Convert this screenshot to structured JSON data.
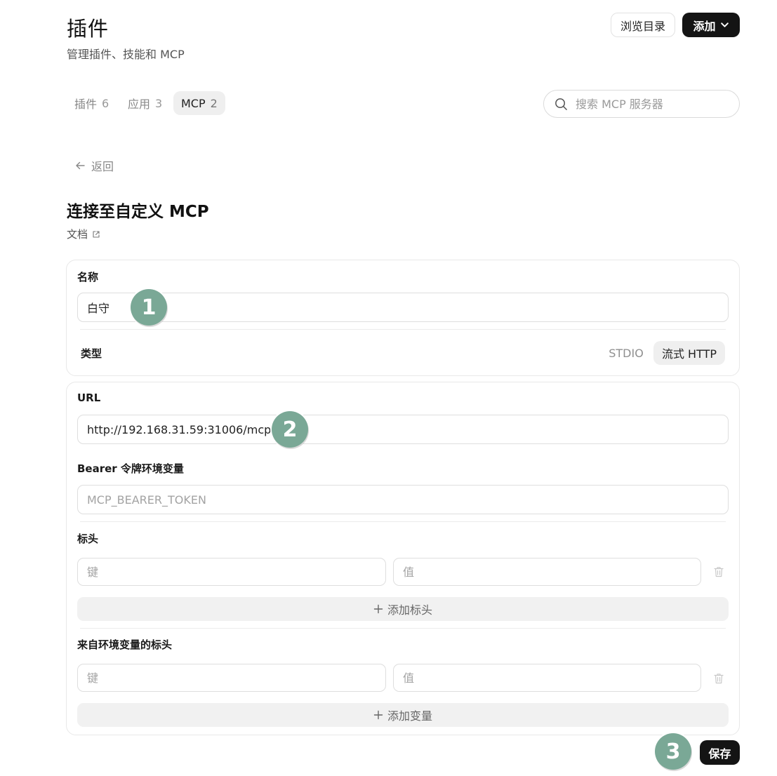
{
  "header": {
    "title": "插件",
    "subtitle": "管理插件、技能和 MCP",
    "browse_label": "浏览目录",
    "add_label": "添加"
  },
  "tabs": [
    {
      "label": "插件",
      "count": "6"
    },
    {
      "label": "应用",
      "count": "3"
    },
    {
      "label": "MCP",
      "count": "2"
    }
  ],
  "search": {
    "placeholder": "搜索 MCP 服务器"
  },
  "back_label": "返回",
  "form": {
    "title": "连接至自定义 MCP",
    "docs_label": "文档",
    "name_label": "名称",
    "name_value": "白守",
    "type_label": "类型",
    "type_options": [
      "STDIO",
      "流式 HTTP"
    ],
    "type_selected": "流式 HTTP",
    "url_label": "URL",
    "url_value": "http://192.168.31.59:31006/mcp",
    "bearer_label": "Bearer 令牌环境变量",
    "bearer_placeholder": "MCP_BEARER_TOKEN",
    "headers_label": "标头",
    "key_placeholder": "键",
    "value_placeholder": "值",
    "add_header_label": "添加标头",
    "env_headers_label": "来自环境变量的标头",
    "add_variable_label": "添加变量",
    "save_label": "保存"
  },
  "annotations": [
    "1",
    "2",
    "3"
  ],
  "colors": {
    "badge": "#7aa896",
    "dark_button": "#141414",
    "active_segment": "#efefef"
  }
}
